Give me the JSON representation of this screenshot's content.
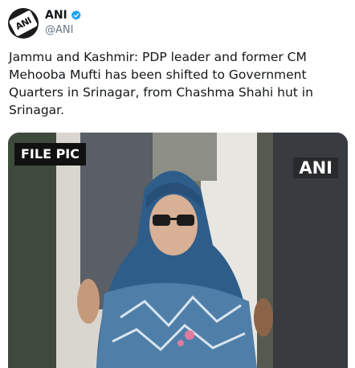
{
  "author": {
    "display_name": "ANI",
    "handle": "@ANI",
    "avatar_text": "ANI",
    "verified": true
  },
  "tweet": {
    "text": "Jammu and Kashmir: PDP leader and former CM\nMehooba Mufti has been shifted to Government\nQuarters in Srinagar, from Chashma Shahi hut in\nSrinagar."
  },
  "media": {
    "badge_left": "FILE PIC",
    "badge_right": "ANI"
  },
  "colors": {
    "verified": "#1da1f2",
    "text": "#14171a",
    "secondary": "#657786"
  }
}
